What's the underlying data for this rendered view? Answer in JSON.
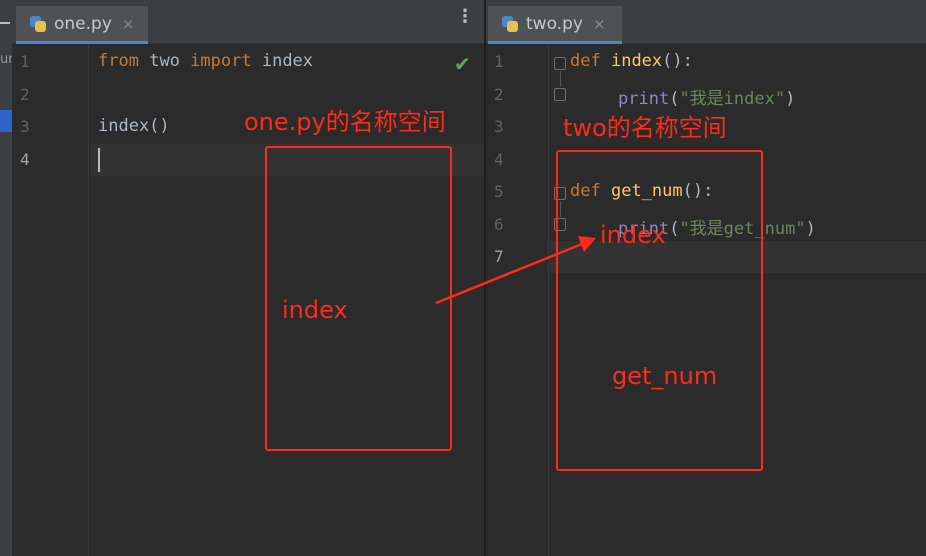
{
  "left_editor": {
    "tab": {
      "filename": "one.py",
      "close": "×"
    },
    "menu_icon": "⋮",
    "lines": [
      "1",
      "2",
      "3",
      "4"
    ],
    "code": {
      "line1": {
        "kw1": "from",
        "mod": "two",
        "kw2": "import",
        "name": "index"
      },
      "line3": "index()"
    },
    "status_icon": "✔"
  },
  "right_editor": {
    "tab": {
      "filename": "two.py",
      "close": "×"
    },
    "lines": [
      "1",
      "2",
      "3",
      "4",
      "5",
      "6",
      "7"
    ],
    "code": {
      "line1": {
        "kw": "def",
        "fn": "index",
        "rest": "():"
      },
      "line2": {
        "bi": "print",
        "open": "(",
        "str": "\"我是index\"",
        "close": ")"
      },
      "line5": {
        "kw": "def",
        "fn": "get_num",
        "rest": "():"
      },
      "line6": {
        "bi": "print",
        "open": "(",
        "str": "\"我是get_num\"",
        "close": ")"
      }
    }
  },
  "sidebar": {
    "partial_label": "ur"
  },
  "annotations": {
    "left_title": "one.py的名称空间",
    "left_item": "index",
    "right_title": "two的名称空间",
    "right_item_index": "index",
    "right_item_getnum": "get_num"
  },
  "colors": {
    "annotation": "#ff2a1a",
    "background": "#2b2b2b",
    "keyword": "#cc7832",
    "function": "#ffc66d",
    "string": "#6a8759"
  }
}
